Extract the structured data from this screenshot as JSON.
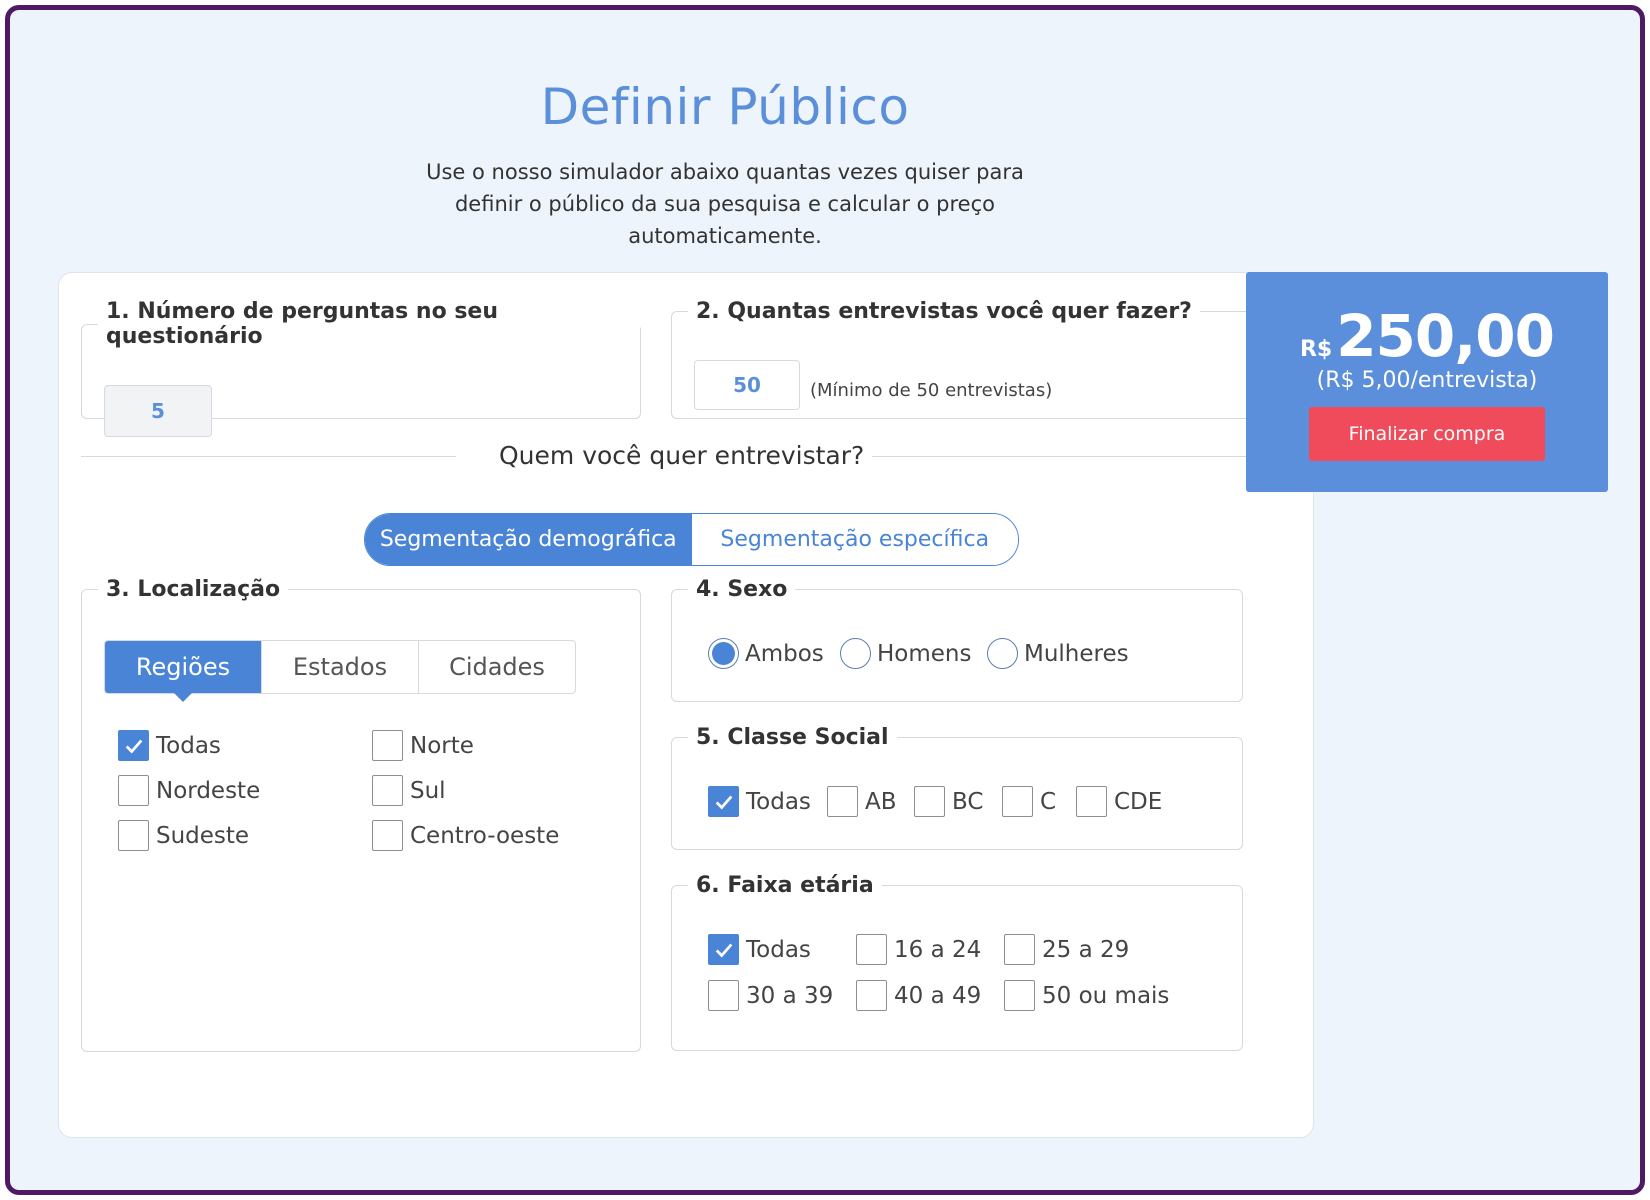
{
  "header": {
    "title": "Definir Público",
    "subtitle": "Use o nosso simulador abaixo quantas vezes quiser para definir o público da sua pesquisa e calcular o preço automaticamente."
  },
  "questions": {
    "label": "1. Número de perguntas no seu questionário",
    "value": "5"
  },
  "interviews": {
    "label": "2. Quantas entrevistas você quer fazer?",
    "value": "50",
    "hint": "(Mínimo de 50 entrevistas)"
  },
  "who": {
    "label": "Quem você quer entrevistar?"
  },
  "segmentation": {
    "demographic": "Segmentação demográfica",
    "specific": "Segmentação específica"
  },
  "location": {
    "label": "3. Localização",
    "tabs": [
      "Regiões",
      "Estados",
      "Cidades"
    ],
    "options": [
      {
        "label": "Todas",
        "checked": true
      },
      {
        "label": "Norte",
        "checked": false
      },
      {
        "label": "Nordeste",
        "checked": false
      },
      {
        "label": "Sul",
        "checked": false
      },
      {
        "label": "Sudeste",
        "checked": false
      },
      {
        "label": "Centro-oeste",
        "checked": false
      }
    ]
  },
  "sex": {
    "label": "4. Sexo",
    "options": [
      {
        "label": "Ambos",
        "selected": true
      },
      {
        "label": "Homens",
        "selected": false
      },
      {
        "label": "Mulheres",
        "selected": false
      }
    ]
  },
  "social_class": {
    "label": "5. Classe Social",
    "options": [
      {
        "label": "Todas",
        "checked": true
      },
      {
        "label": "AB",
        "checked": false
      },
      {
        "label": "BC",
        "checked": false
      },
      {
        "label": "C",
        "checked": false
      },
      {
        "label": "CDE",
        "checked": false
      }
    ]
  },
  "age": {
    "label": "6. Faixa etária",
    "options": [
      {
        "label": "Todas",
        "checked": true
      },
      {
        "label": "16 a 24",
        "checked": false
      },
      {
        "label": "25 a 29",
        "checked": false
      },
      {
        "label": "30 a 39",
        "checked": false
      },
      {
        "label": "40 a 49",
        "checked": false
      },
      {
        "label": "50 ou mais",
        "checked": false
      }
    ]
  },
  "price": {
    "currency": "R$",
    "value": "250,00",
    "per_interview": "(R$ 5,00/entrevista)",
    "button": "Finalizar compra"
  },
  "colors": {
    "accent": "#4a84d6",
    "price_bg": "#5b8fdb",
    "buy_button": "#f04b5b",
    "frame": "#4d1a63"
  }
}
